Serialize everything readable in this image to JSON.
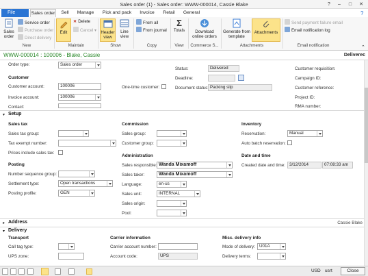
{
  "window": {
    "title": "Sales order (1) - Sales order: WWW-000014, Cassie Blake",
    "help": "?",
    "minimize": "–",
    "maximize": "□",
    "close": "✕"
  },
  "tabs": [
    "File",
    "Sales order",
    "Sell",
    "Manage",
    "Pick and pack",
    "Invoice",
    "Retail",
    "General"
  ],
  "ribbon": {
    "new": {
      "big": "Sales order",
      "service": "Service order",
      "purchase": "Purchase order",
      "direct": "Direct delivery",
      "label": "New"
    },
    "maintain": {
      "edit": "Edit",
      "delete": "Delete",
      "cancel": "Cancel",
      "label": "Maintain"
    },
    "show": {
      "header": "Header view",
      "line": "Line view",
      "label": "Show"
    },
    "copy": {
      "from_all": "From all",
      "from_journal": "From journal",
      "label": "Copy"
    },
    "view": {
      "totals": "Totals",
      "label": "View"
    },
    "commerce": {
      "download": "Download online orders",
      "label": "Commerce S..."
    },
    "attachments": {
      "generate": "Generate from template",
      "attach": "Attachments",
      "label": "Attachments"
    },
    "email": {
      "resend": "Send payment failure email",
      "log": "Email notification log",
      "label": "Email notification"
    }
  },
  "header": {
    "record": "WWW-000014 : 100006 - Blake, Cassie",
    "status": "Deliverec"
  },
  "top": {
    "order_type_lbl": "Order type:",
    "order_type": "Sales order",
    "customer_hd": "Customer",
    "cust_acct_lbl": "Customer account:",
    "cust_acct": "100006",
    "invoice_acct_lbl": "Invoice account:",
    "invoice_acct": "100006",
    "contact_lbl": "Contact:",
    "one_time_lbl": "One-time customer:",
    "status_lbl": "Status:",
    "status": "Delivered",
    "deadline_lbl": "Deadline:",
    "doc_status_lbl": "Document status:",
    "doc_status": "Packing slip",
    "cust_req_lbl": "Customer requisition:",
    "campaign_lbl": "Campaign ID:",
    "cust_ref_lbl": "Customer reference:",
    "project_lbl": "Project ID:",
    "rma_lbl": "RMA number:"
  },
  "setup": {
    "title": "Setup",
    "sales_tax_hd": "Sales tax",
    "tax_group_lbl": "Sales tax group:",
    "tax_exempt_lbl": "Tax exempt number:",
    "prices_incl_lbl": "Prices include sales tax:",
    "posting_hd": "Posting",
    "num_seq_lbl": "Number sequence group:",
    "settlement_lbl": "Settlement type:",
    "settlement": "Open transactions",
    "posting_profile_lbl": "Posting profile:",
    "posting_profile": "GEN",
    "commission_hd": "Commission",
    "comm_sales_group_lbl": "Sales group:",
    "comm_cust_group_lbl": "Customer group:",
    "admin_hd": "Administration",
    "responsible_lbl": "Sales responsible:",
    "responsible": "Wanda Mixamoff",
    "taker_lbl": "Sales taker:",
    "taker": "Wanda Mixamoff",
    "language_lbl": "Language:",
    "language": "en-us",
    "unit_lbl": "Sales unit:",
    "unit": "INTERNAL",
    "origin_lbl": "Sales origin:",
    "pool_lbl": "Pool:",
    "inventory_hd": "Inventory",
    "reservation_lbl": "Reservation:",
    "reservation": "Manual",
    "auto_batch_lbl": "Auto batch reservation:",
    "datetime_hd": "Date and time",
    "created_lbl": "Created date and time:",
    "created_date": "3/12/2014",
    "created_time": "07:08:33 am"
  },
  "address": {
    "title": "Address",
    "summary": "Cassie Blake"
  },
  "delivery": {
    "title": "Delivery",
    "transport_hd": "Transport",
    "call_tag_lbl": "Call tag type:",
    "ups_zone_lbl": "UPS zone:",
    "carrier_hd": "Carrier information",
    "carrier_acct_lbl": "Carrier account number:",
    "acct_code_lbl": "Account code:",
    "acct_code": "UPS",
    "misc_hd": "Misc. delivery info",
    "mode_lbl": "Mode of delivery:",
    "mode": "U01A",
    "terms_lbl": "Delivery terms:"
  },
  "statusbar": {
    "currency": "USD",
    "company": "usrt",
    "close": "Close"
  }
}
